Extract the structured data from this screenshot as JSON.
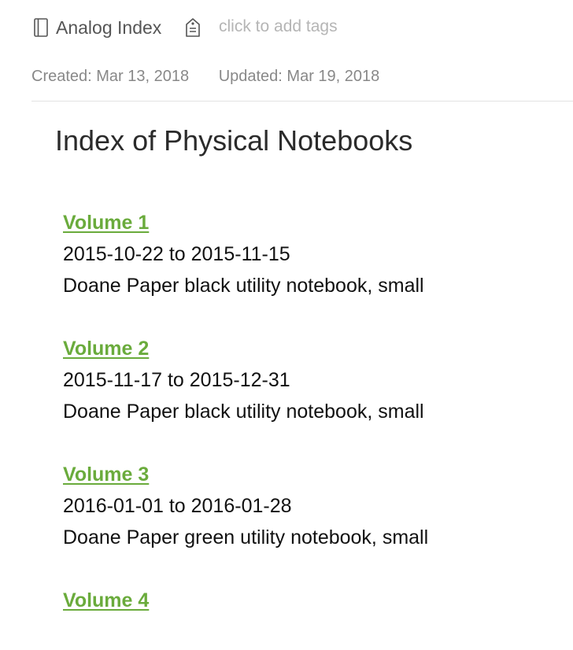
{
  "header": {
    "notebook_name": "Analog Index",
    "tag_placeholder": "click to add tags"
  },
  "meta": {
    "created": "Created: Mar 13, 2018",
    "updated": "Updated: Mar 19, 2018"
  },
  "note": {
    "title": "Index of Physical Notebooks",
    "volumes": [
      {
        "title": "Volume 1",
        "dates": "2015-10-22 to 2015-11-15",
        "description": "Doane Paper black utility notebook, small"
      },
      {
        "title": "Volume 2",
        "dates": "2015-11-17 to 2015-12-31",
        "description": "Doane Paper black utility notebook, small"
      },
      {
        "title": "Volume 3",
        "dates": "2016-01-01 to 2016-01-28",
        "description": "Doane Paper green utility notebook, small"
      },
      {
        "title": "Volume 4",
        "dates": "",
        "description": ""
      }
    ]
  },
  "colors": {
    "link": "#6aab3c",
    "meta_text": "#888888",
    "placeholder": "#b5b5b5"
  },
  "icons": [
    "notebook-icon",
    "tag-icon"
  ]
}
